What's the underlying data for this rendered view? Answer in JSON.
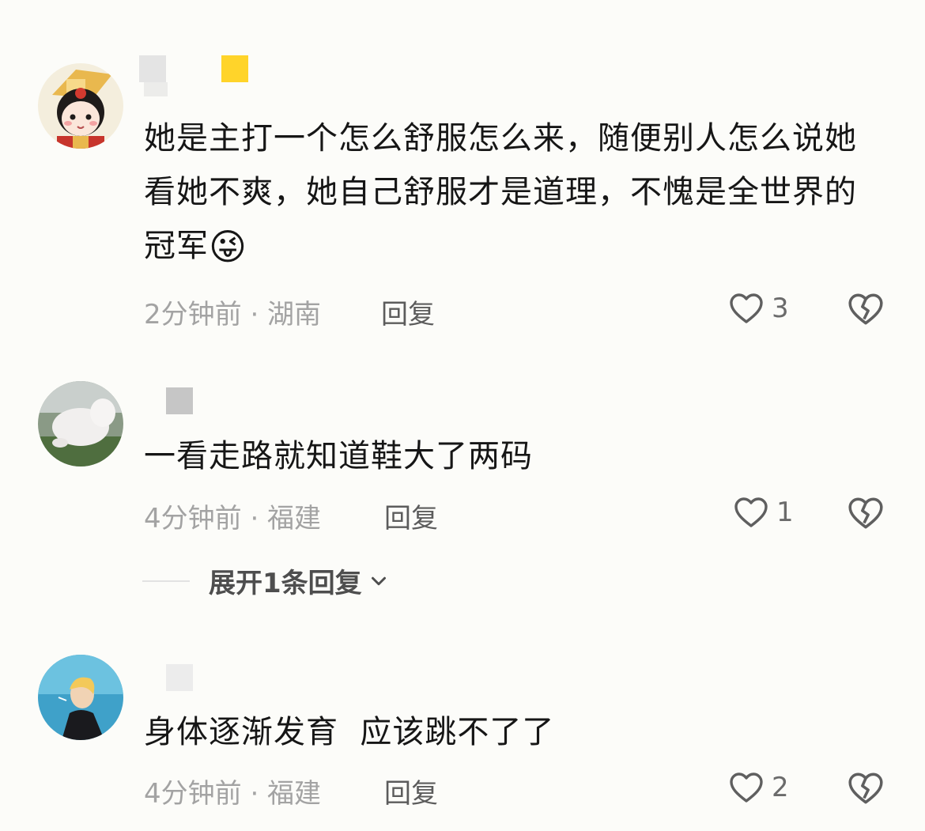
{
  "comments": [
    {
      "text": "她是主打一个怎么舒服怎么来，随便别人怎么说她看她不爽，她自己舒服才是道理，不愧是全世界的冠军",
      "emoji": "😜",
      "time_location": "2分钟前 · 湖南",
      "reply_label": "回复",
      "likes": "3"
    },
    {
      "text": "一看走路就知道鞋大了两码",
      "time_location": "4分钟前 · 福建",
      "reply_label": "回复",
      "likes": "1",
      "expand_label": "展开1条回复"
    },
    {
      "text": "身体逐渐发育  应该跳不了了",
      "time_location": "4分钟前 · 福建",
      "reply_label": "回复",
      "likes": "2"
    }
  ],
  "icons": {
    "like": "heart-outline-icon",
    "dislike": "broken-heart-icon",
    "expand": "chevron-down-icon"
  },
  "colors": {
    "background": "#fcfcf9",
    "text": "#161616",
    "meta": "#a3a3a3",
    "reply": "#5c5c5c",
    "icon": "#5f5f5f"
  }
}
